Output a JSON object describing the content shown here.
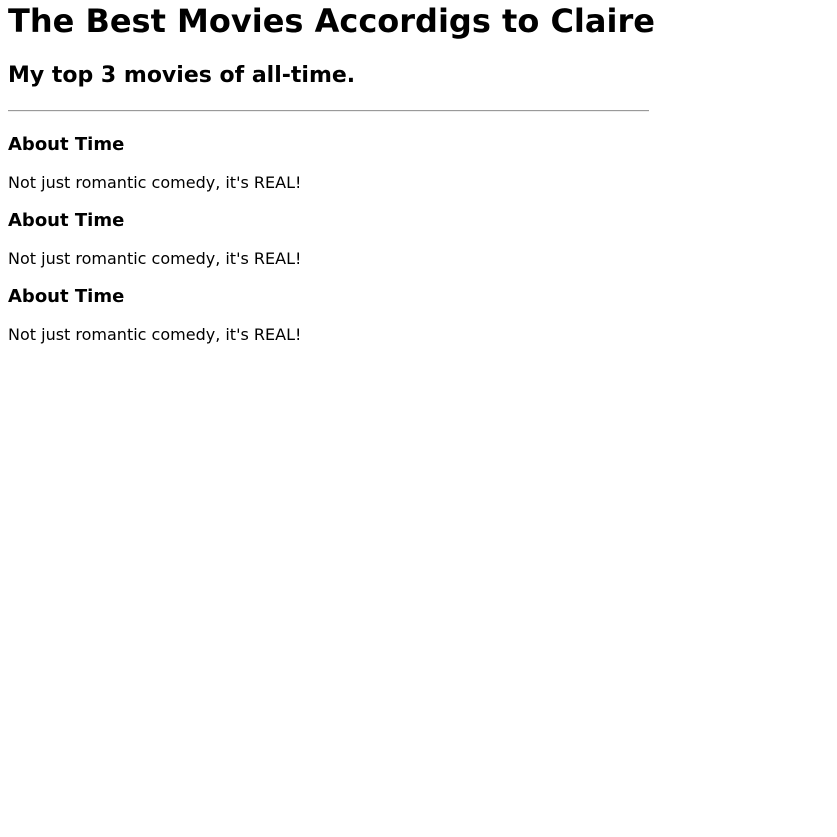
{
  "header": {
    "title": "The Best Movies Accordigs to Claire",
    "subtitle": "My top 3 movies of all-time."
  },
  "movies": [
    {
      "title": "About Time",
      "description": "Not just romantic comedy, it's REAL!"
    },
    {
      "title": "About Time",
      "description": "Not just romantic comedy, it's REAL!"
    },
    {
      "title": "About Time",
      "description": "Not just romantic comedy, it's REAL!"
    }
  ]
}
